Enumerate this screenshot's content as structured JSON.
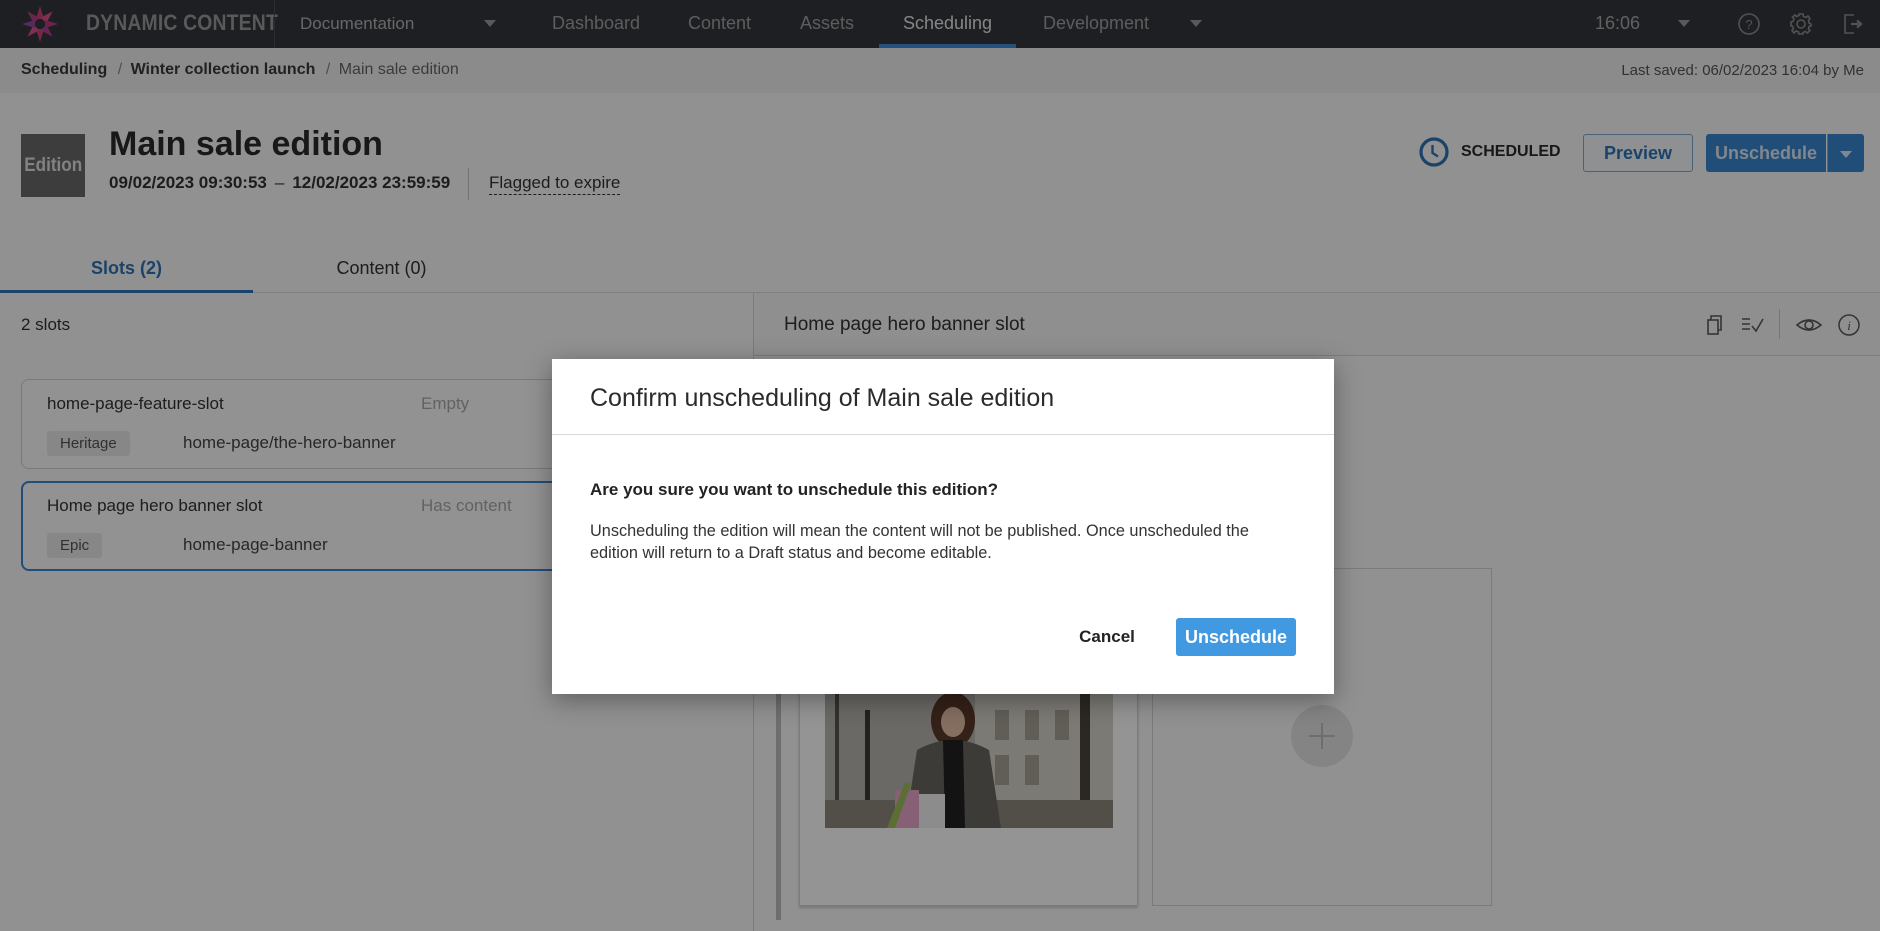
{
  "app": {
    "brand": "DYNAMIC CONTENT",
    "hub_selector": "Documentation",
    "nav": [
      {
        "label": "Dashboard",
        "active": false
      },
      {
        "label": "Content",
        "active": false
      },
      {
        "label": "Assets",
        "active": false
      },
      {
        "label": "Scheduling",
        "active": true
      },
      {
        "label": "Development",
        "active": false
      }
    ],
    "time": "16:06",
    "icons": [
      "help-icon",
      "settings-icon",
      "logout-icon"
    ]
  },
  "breadcrumb": {
    "items": [
      "Scheduling",
      "Winter collection launch",
      "Main sale edition"
    ],
    "separator": "/",
    "last_saved": "Last saved: 06/02/2023 16:04 by Me"
  },
  "edition": {
    "badge": "Edition",
    "title": "Main sale edition",
    "start": "09/02/2023 09:30:53",
    "date_separator": "–",
    "end": "12/02/2023 23:59:59",
    "flag": "Flagged to expire",
    "status": "SCHEDULED",
    "preview_label": "Preview",
    "unschedule_label": "Unschedule"
  },
  "tabs": [
    {
      "label": "Slots (2)",
      "active": true
    },
    {
      "label": "Content (0)",
      "active": false
    }
  ],
  "slots": {
    "count_label": "2 slots",
    "items": [
      {
        "name": "home-page-feature-slot",
        "status": "Empty",
        "tag": "Heritage",
        "key": "home-page/the-hero-banner",
        "selected": false
      },
      {
        "name": "Home page hero banner slot",
        "status": "Has content",
        "tag": "Epic",
        "key": "home-page-banner",
        "selected": true
      }
    ]
  },
  "slot_detail": {
    "title": "Home page hero banner slot",
    "toolbar_icons": [
      "copy-icon",
      "validate-icon",
      "preview-icon",
      "info-icon"
    ]
  },
  "modal": {
    "title": "Confirm unscheduling of Main sale edition",
    "question": "Are you sure you want to unschedule this edition?",
    "body": "Unscheduling the edition will mean the content will not be published. Once unscheduled the edition will return to a Draft status and become editable.",
    "cancel_label": "Cancel",
    "confirm_label": "Unschedule"
  },
  "colors": {
    "accent": "#3a86d0",
    "confirm_button": "#4199e1",
    "topnav": "#33363d"
  }
}
